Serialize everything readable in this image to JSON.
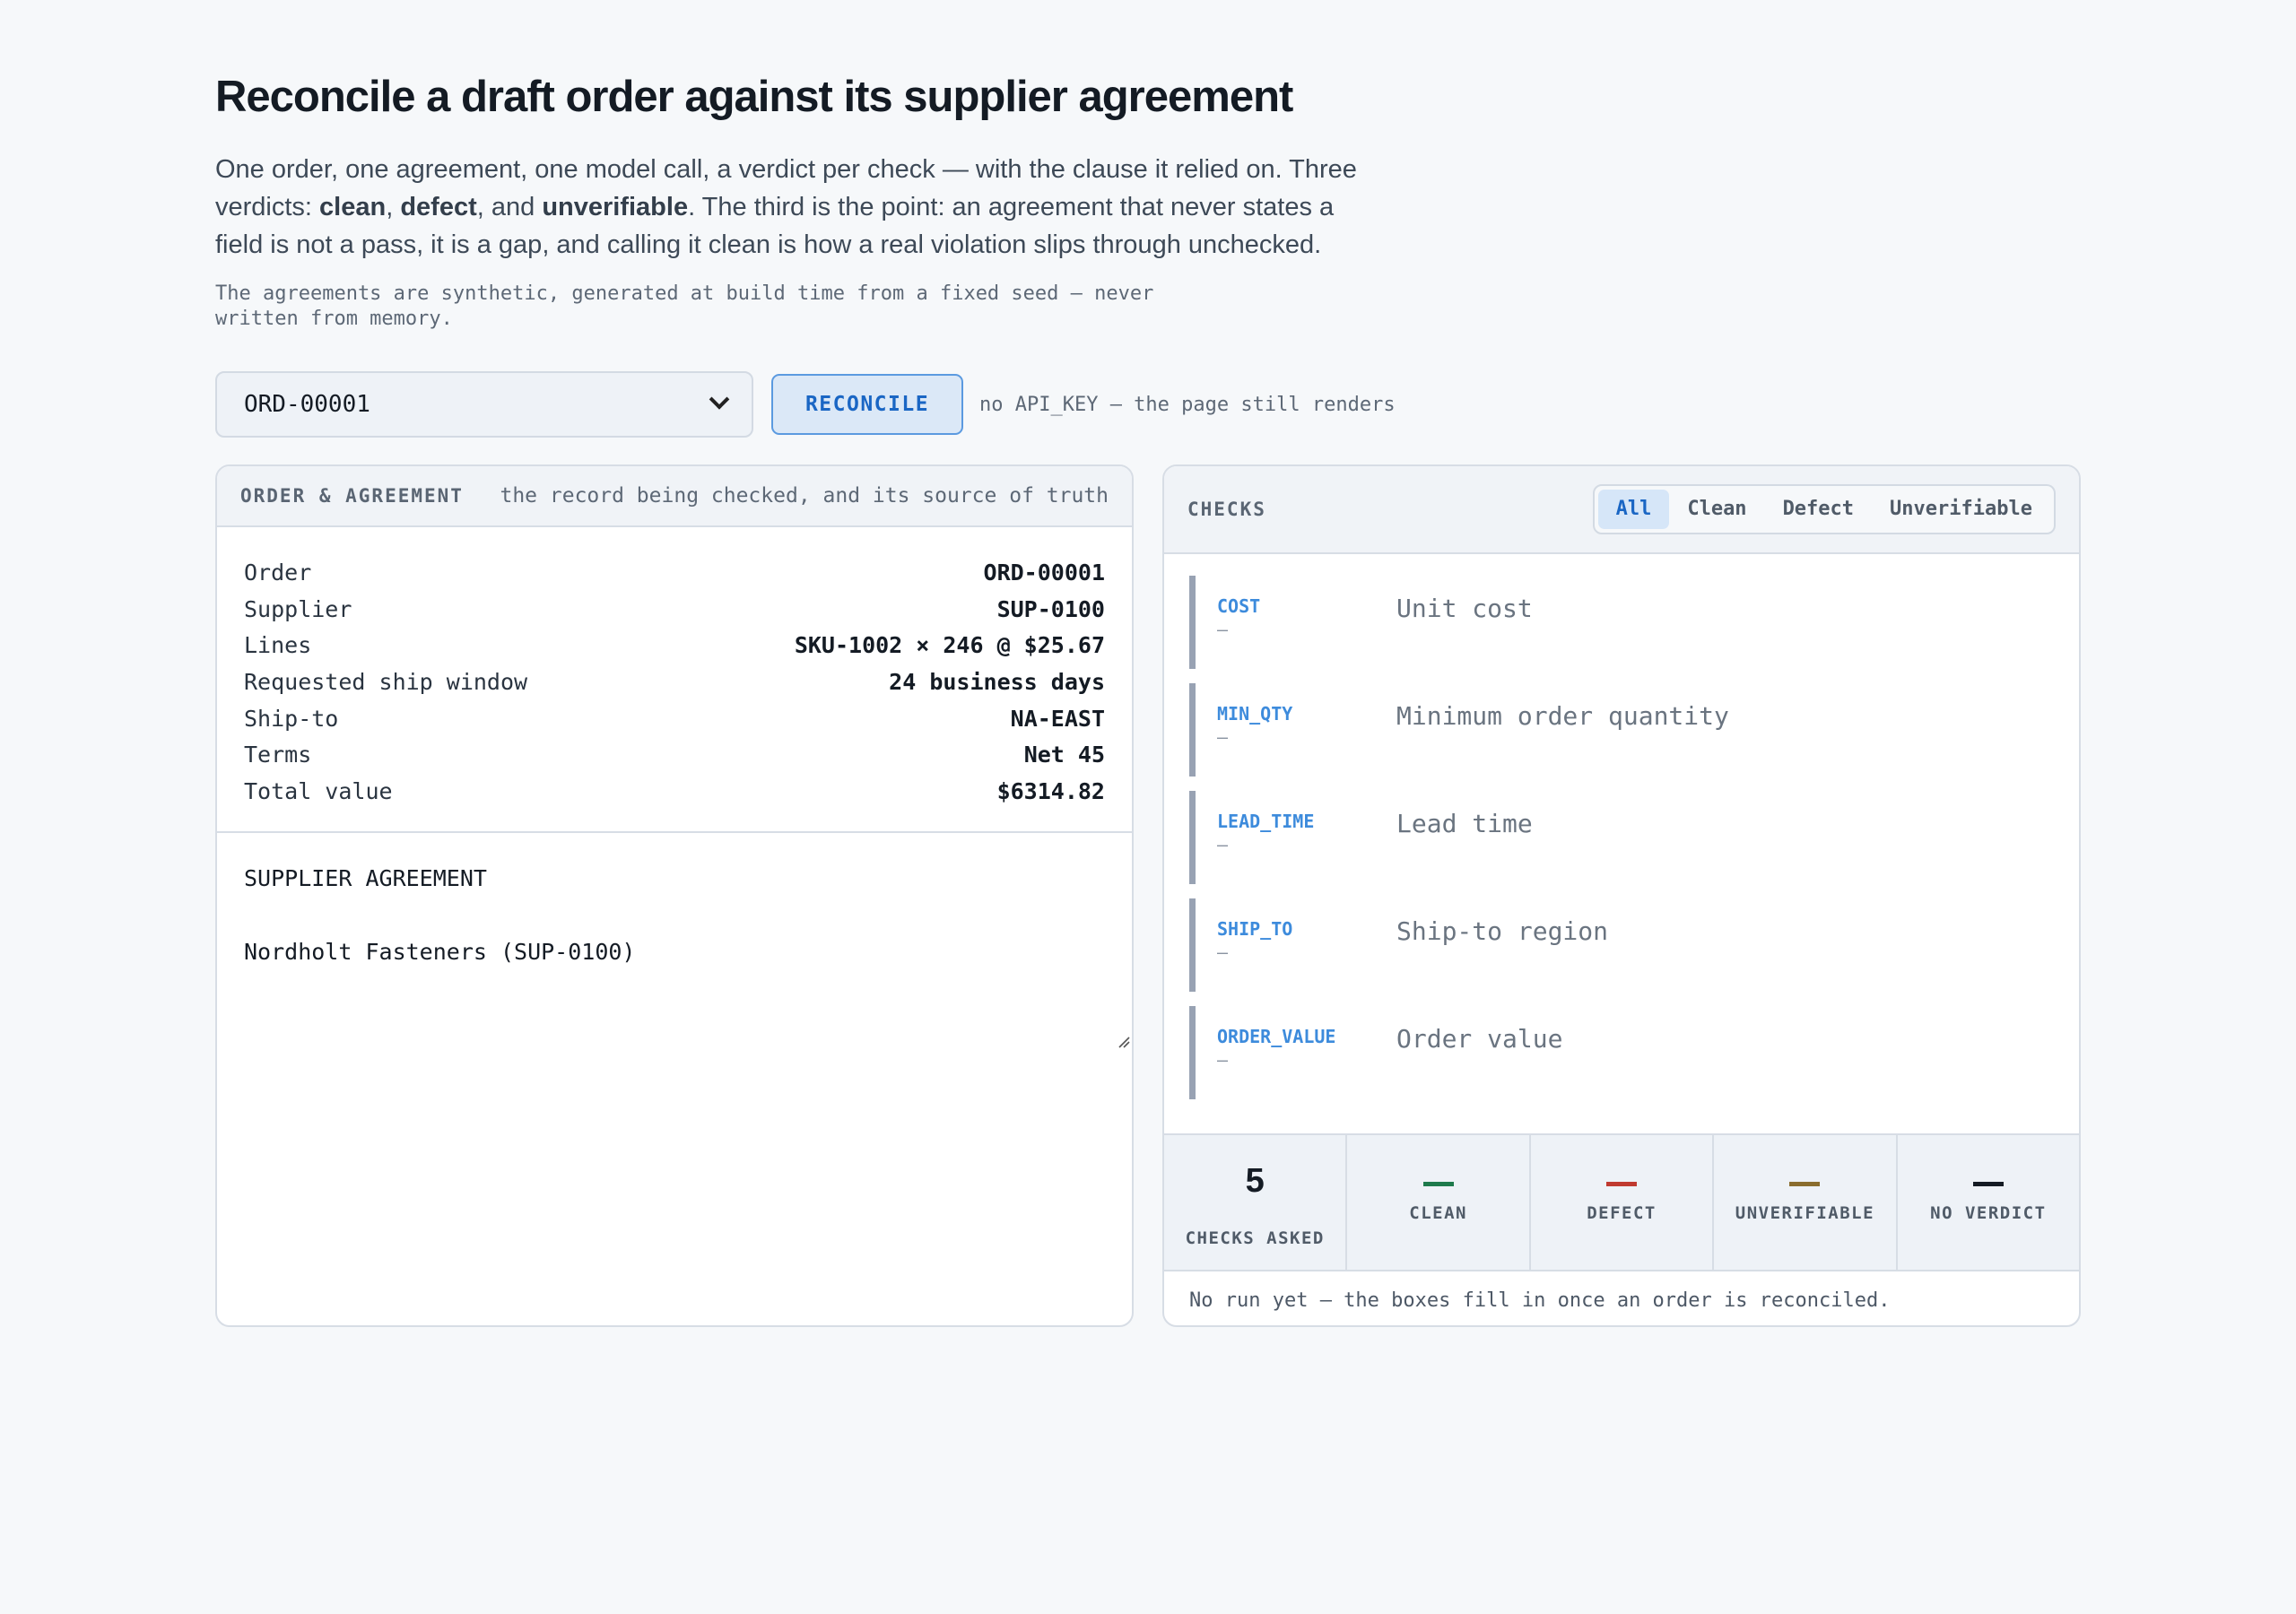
{
  "header": {
    "title": "Reconcile a draft order against its supplier agreement",
    "lede_1": "One order, one agreement, one model call, a verdict per check — with the clause it relied on. Three verdicts: ",
    "w_clean": "clean",
    "sep_1": ", ",
    "w_defect": "defect",
    "sep_2": ", and ",
    "w_unverifiable": "unverifiable",
    "lede_2": ". The third is the point: an agreement that never states a field is not a pass, it is a gap, and calling it clean is how a real violation slips through unchecked.",
    "note": "The agreements are synthetic, generated at build time from a fixed seed — never written from memory."
  },
  "controls": {
    "order_select": "ORD-00001",
    "reconcile_label": "RECONCILE",
    "hint": "no API_KEY — the page still renders"
  },
  "left": {
    "title": "ORDER & AGREEMENT",
    "subtitle": "the record being checked, and its source of truth",
    "rows": [
      {
        "k": "Order",
        "v": "ORD-00001"
      },
      {
        "k": "Supplier",
        "v": "SUP-0100"
      },
      {
        "k": "Lines",
        "v": "SKU-1002 × 246 @ $25.67"
      },
      {
        "k": "Requested ship window",
        "v": "24 business days"
      },
      {
        "k": "Ship-to",
        "v": "NA-EAST"
      },
      {
        "k": "Terms",
        "v": "Net 45"
      },
      {
        "k": "Total value",
        "v": "$6314.82"
      }
    ],
    "agreement_heading": "SUPPLIER AGREEMENT",
    "agreement_party": "Nordholt Fasteners (SUP-0100)"
  },
  "right": {
    "title": "CHECKS",
    "filters": [
      "All",
      "Clean",
      "Defect",
      "Unverifiable"
    ],
    "checks": [
      {
        "code": "COST",
        "dash": "—",
        "label": "Unit cost"
      },
      {
        "code": "MIN_QTY",
        "dash": "—",
        "label": "Minimum order quantity"
      },
      {
        "code": "LEAD_TIME",
        "dash": "—",
        "label": "Lead time"
      },
      {
        "code": "SHIP_TO",
        "dash": "—",
        "label": "Ship-to region"
      },
      {
        "code": "ORDER_VALUE",
        "dash": "—",
        "label": "Order value"
      }
    ],
    "stats": [
      {
        "num": "5",
        "cap": "CHECKS ASKED"
      },
      {
        "cap": "CLEAN",
        "color": "#1e7a4c"
      },
      {
        "cap": "DEFECT",
        "color": "#c03a30"
      },
      {
        "cap": "UNVERIFIABLE",
        "color": "#8a6d2e"
      },
      {
        "cap": "NO VERDICT",
        "color": "#141b24"
      }
    ],
    "footer": "No run yet — the boxes fill in once an order is reconciled."
  }
}
